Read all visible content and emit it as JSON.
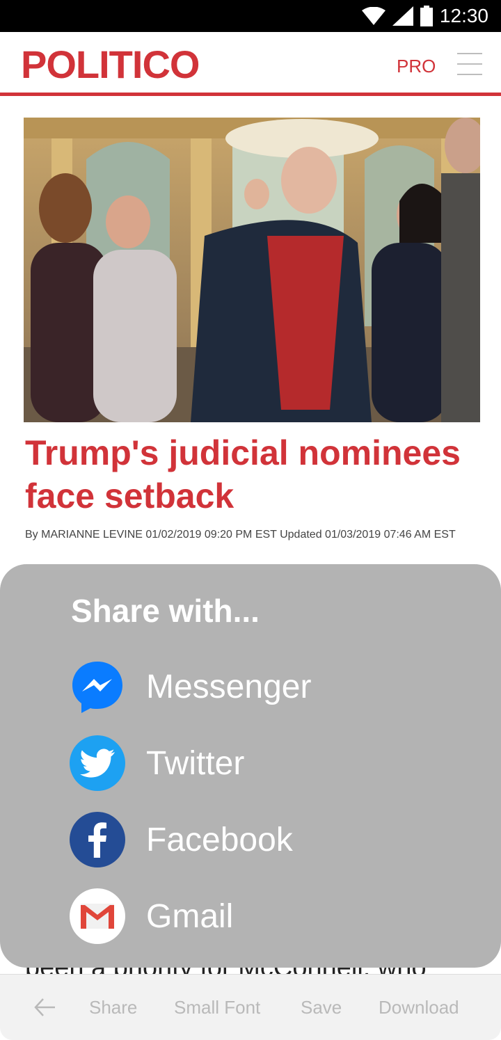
{
  "status_bar": {
    "time": "12:30"
  },
  "header": {
    "logo": "POLITICO",
    "pro_label": "PRO"
  },
  "article": {
    "headline": "Trump's judicial nominees face setback",
    "byline": "By MARIANNE LEVINE 01/02/2019 09:20 PM EST Updated 01/03/2019 07:46 AM EST",
    "partial_body": "been a priority for McConnell, who"
  },
  "share_sheet": {
    "title": "Share with...",
    "options": [
      {
        "label": "Messenger",
        "icon": "messenger-icon"
      },
      {
        "label": "Twitter",
        "icon": "twitter-icon"
      },
      {
        "label": "Facebook",
        "icon": "facebook-icon"
      },
      {
        "label": "Gmail",
        "icon": "gmail-icon"
      }
    ]
  },
  "bottom_bar": {
    "back_icon": "back-arrow-icon",
    "share": "Share",
    "small_font": "Small Font",
    "save": "Save",
    "download": "Download"
  },
  "colors": {
    "brand_red": "#d13339",
    "sheet_gray": "#b3b3b3",
    "messenger_blue": "#0a7cff",
    "twitter_blue": "#1da1f2",
    "facebook_blue": "#3b5998"
  }
}
